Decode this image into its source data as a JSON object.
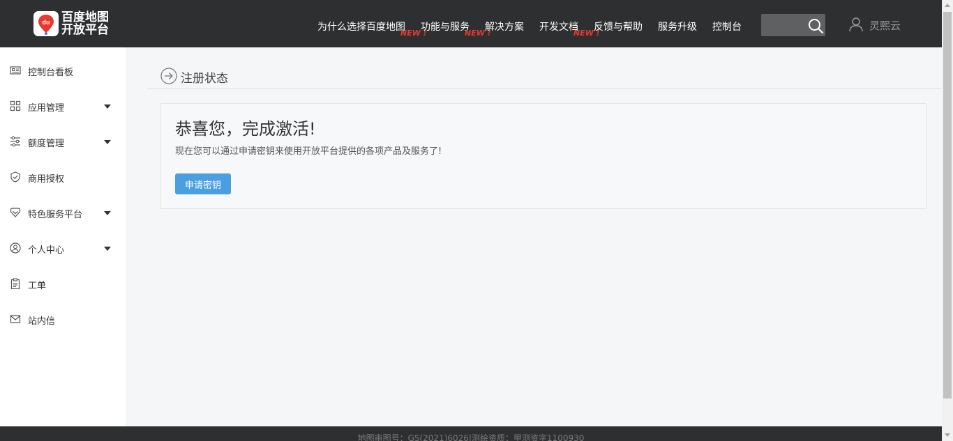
{
  "header": {
    "logo_text_line1": "百度地图",
    "logo_text_line2": "开放平台",
    "logo_badge": "du",
    "nav": [
      {
        "label": "为什么选择百度地图",
        "new": false
      },
      {
        "label": "功能与服务",
        "new": true
      },
      {
        "label": "解决方案",
        "new": true
      },
      {
        "label": "开发文档",
        "new": true
      },
      {
        "label": "反馈与帮助",
        "new": false
      },
      {
        "label": "服务升级",
        "new": false
      },
      {
        "label": "控制台",
        "new": false
      }
    ],
    "new_badge": "NEW !",
    "search_icon": "search-icon",
    "user_icon": "user-icon",
    "user_name": "灵熙云"
  },
  "sidebar": {
    "items": [
      {
        "label": "控制台看板",
        "icon": "dashboard-card-icon",
        "expandable": false
      },
      {
        "label": "应用管理",
        "icon": "grid-icon",
        "expandable": true
      },
      {
        "label": "额度管理",
        "icon": "sliders-icon",
        "expandable": true
      },
      {
        "label": "商用授权",
        "icon": "shield-check-icon",
        "expandable": false
      },
      {
        "label": "特色服务平台",
        "icon": "diamond-tag-icon",
        "expandable": true
      },
      {
        "label": "个人中心",
        "icon": "user-circle-icon",
        "expandable": true
      },
      {
        "label": "工单",
        "icon": "clipboard-icon",
        "expandable": false
      },
      {
        "label": "站内信",
        "icon": "mail-icon",
        "expandable": false
      }
    ]
  },
  "main": {
    "heading": "注册状态",
    "card": {
      "title": "恭喜您，完成激活!",
      "description": "现在您可以通过申请密钥来使用开放平台提供的各项产品及服务了!",
      "button_label": "申请密钥"
    }
  },
  "footer": {
    "text": "地图审图号：GS(2021)6026|测绘资质：甲测资字1100930"
  },
  "colors": {
    "header_bg": "#2e2f31",
    "accent_button": "#4a9fe0",
    "new_badge": "#e53a2f"
  }
}
